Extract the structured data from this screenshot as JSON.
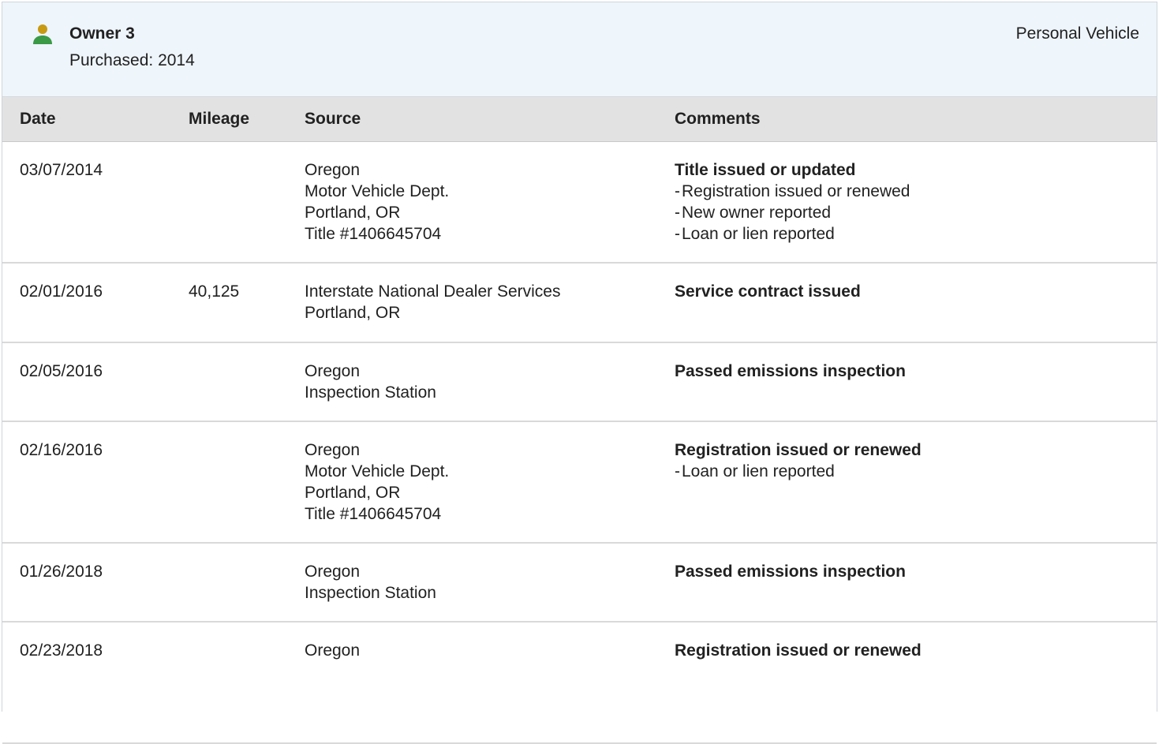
{
  "owner": {
    "name": "Owner 3",
    "purchased": "Purchased: 2014",
    "vehicle_type": "Personal Vehicle",
    "icon": "person-icon",
    "icon_colors": {
      "head": "#c79a12",
      "body": "#3a9a46"
    }
  },
  "table": {
    "headers": {
      "date": "Date",
      "mileage": "Mileage",
      "source": "Source",
      "comments": "Comments"
    },
    "rows": [
      {
        "date": "03/07/2014",
        "mileage": "",
        "source": [
          "Oregon",
          "Motor Vehicle Dept.",
          "Portland, OR",
          "Title #1406645704"
        ],
        "comment_title": "Title issued or updated",
        "comment_items": [
          "Registration issued or renewed",
          "New owner reported",
          "Loan or lien reported"
        ]
      },
      {
        "date": "02/01/2016",
        "mileage": "40,125",
        "source": [
          "Interstate National Dealer Services",
          "Portland, OR"
        ],
        "comment_title": "Service contract issued",
        "comment_items": []
      },
      {
        "date": "02/05/2016",
        "mileage": "",
        "source": [
          "Oregon",
          "Inspection Station"
        ],
        "comment_title": "Passed emissions inspection",
        "comment_items": []
      },
      {
        "date": "02/16/2016",
        "mileage": "",
        "source": [
          "Oregon",
          "Motor Vehicle Dept.",
          "Portland, OR",
          "Title #1406645704"
        ],
        "comment_title": "Registration issued or renewed",
        "comment_items": [
          "Loan or lien reported"
        ]
      },
      {
        "date": "01/26/2018",
        "mileage": "",
        "source": [
          "Oregon",
          "Inspection Station"
        ],
        "comment_title": "Passed emissions inspection",
        "comment_items": []
      },
      {
        "date": "02/23/2018",
        "mileage": "",
        "source": [
          "Oregon"
        ],
        "comment_title": "Registration issued or renewed",
        "comment_items": []
      }
    ]
  }
}
